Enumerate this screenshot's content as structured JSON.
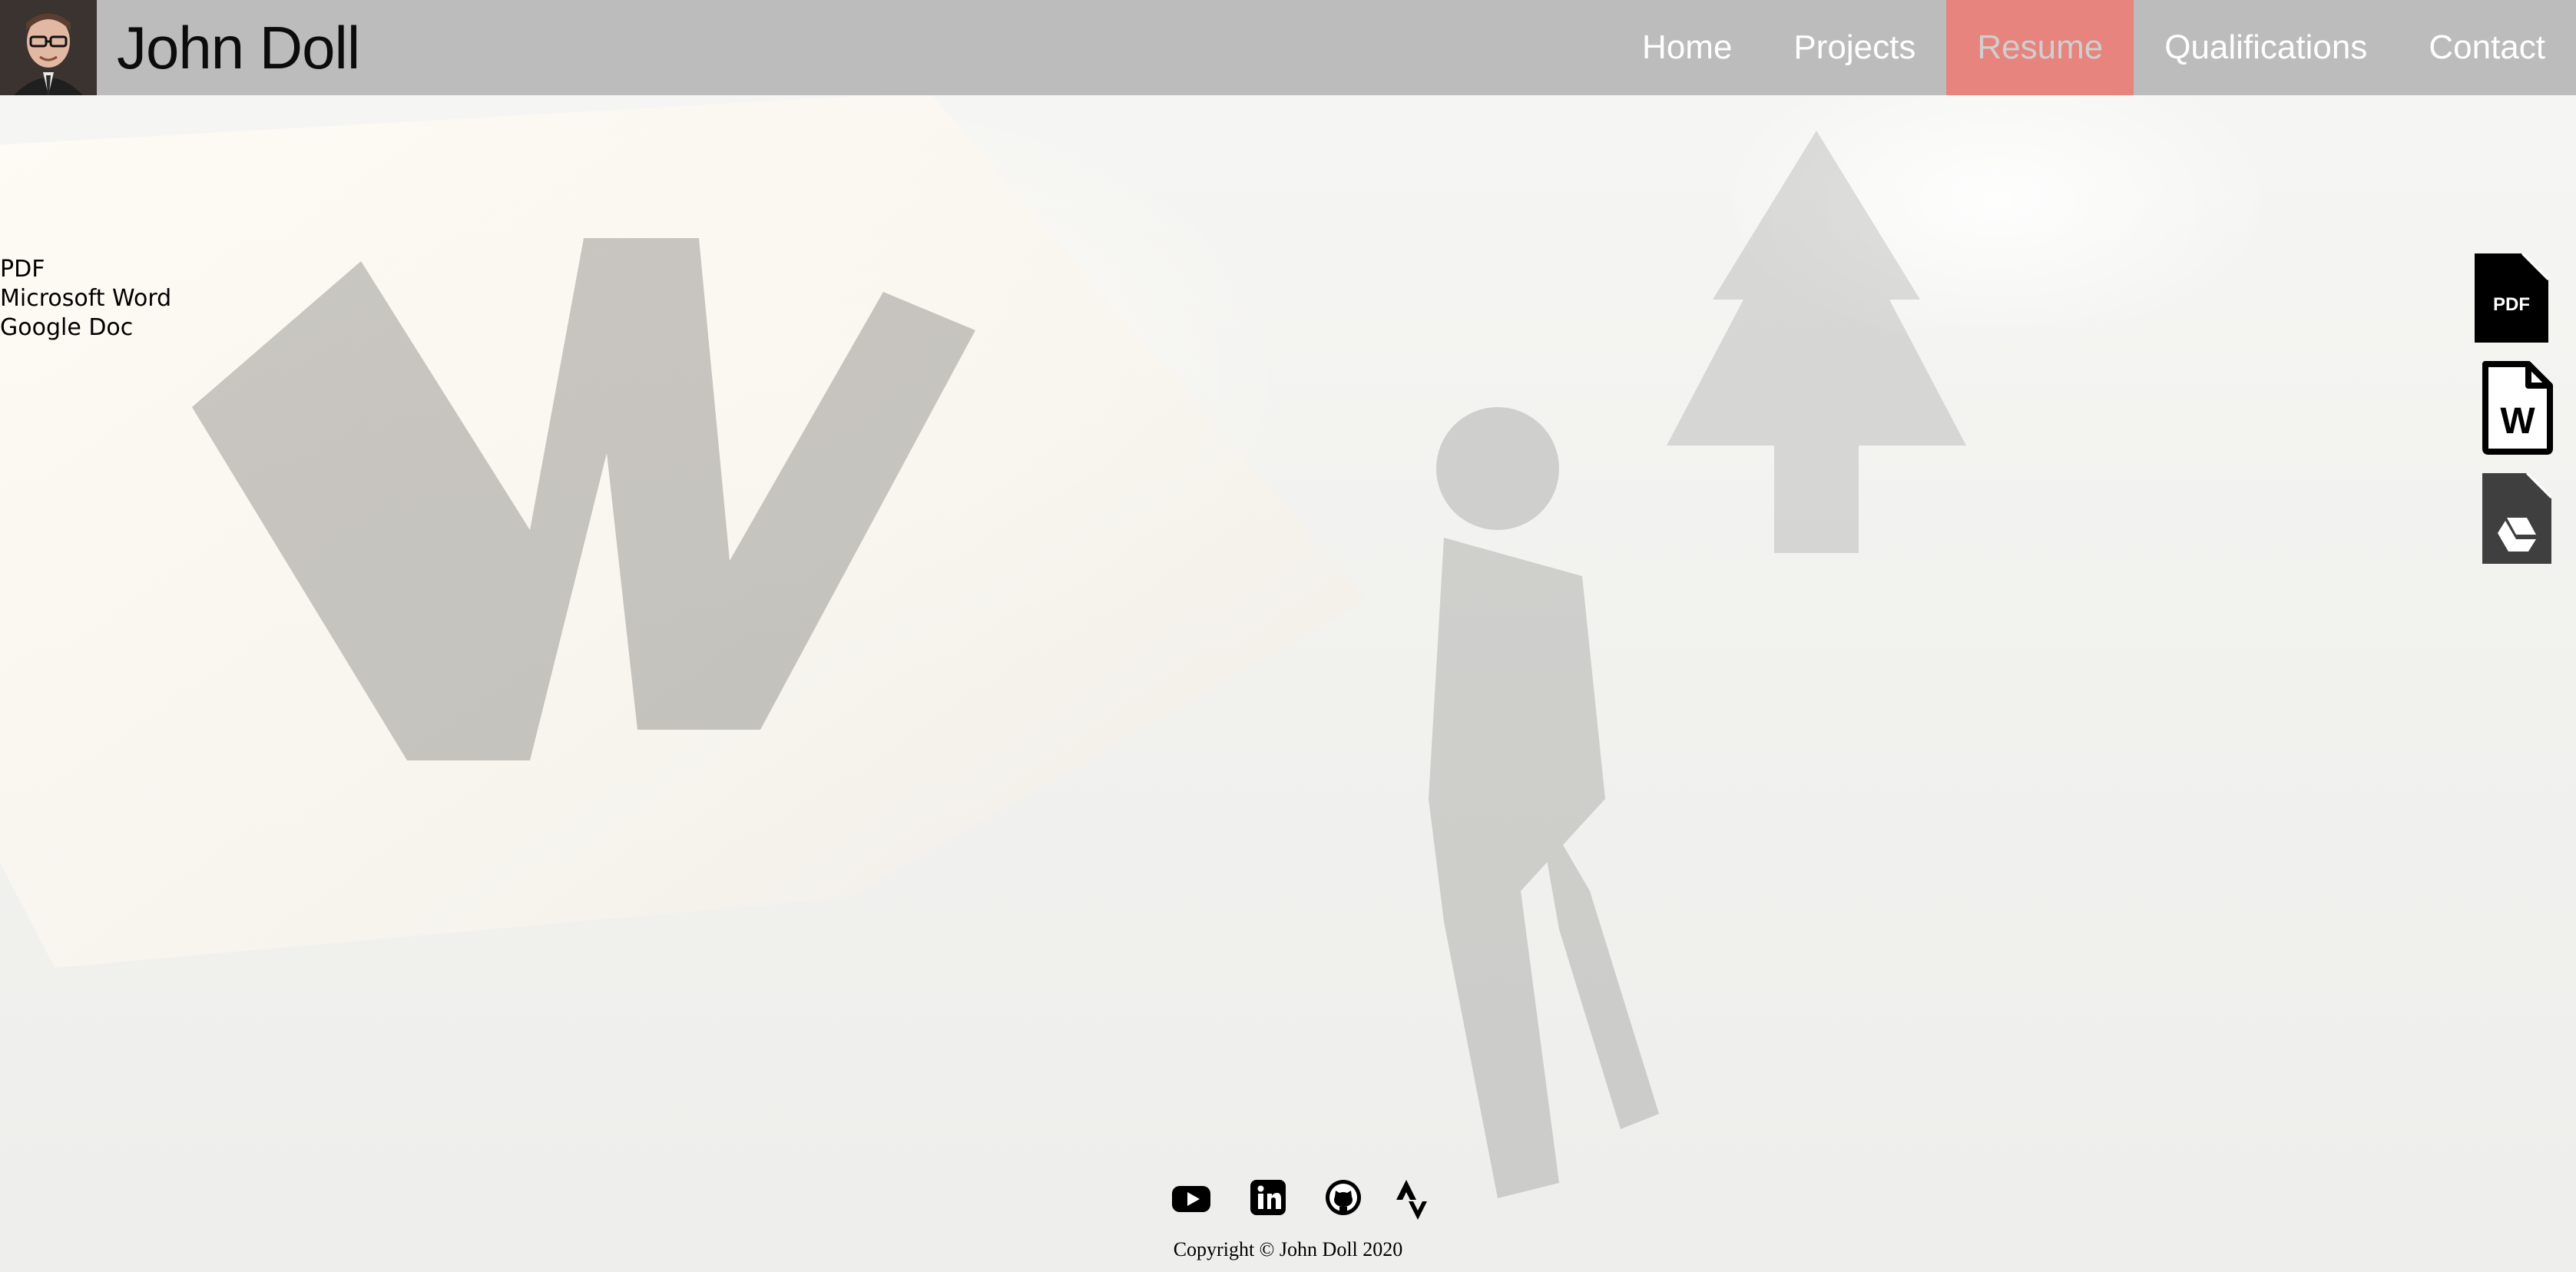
{
  "site": {
    "name": "John Doll"
  },
  "nav": {
    "items": [
      {
        "label": "Home",
        "active": false
      },
      {
        "label": "Projects",
        "active": false
      },
      {
        "label": "Resume",
        "active": true
      },
      {
        "label": "Qualifications",
        "active": false
      },
      {
        "label": "Contact",
        "active": false
      }
    ],
    "active_color": "#e7847d",
    "bar_color": "#bcbcbc"
  },
  "downloads": {
    "links": [
      {
        "label": "PDF",
        "icon": "pdf-file-icon"
      },
      {
        "label": "Microsoft Word",
        "icon": "word-file-icon"
      },
      {
        "label": "Google Doc",
        "icon": "google-drive-file-icon"
      }
    ],
    "pdf_icon_text": "PDF",
    "word_icon_text": "W"
  },
  "footer": {
    "social": [
      {
        "name": "youtube-icon"
      },
      {
        "name": "linkedin-icon"
      },
      {
        "name": "github-icon"
      },
      {
        "name": "strava-icon"
      }
    ],
    "copyright": "Copyright © John Doll 2020"
  }
}
